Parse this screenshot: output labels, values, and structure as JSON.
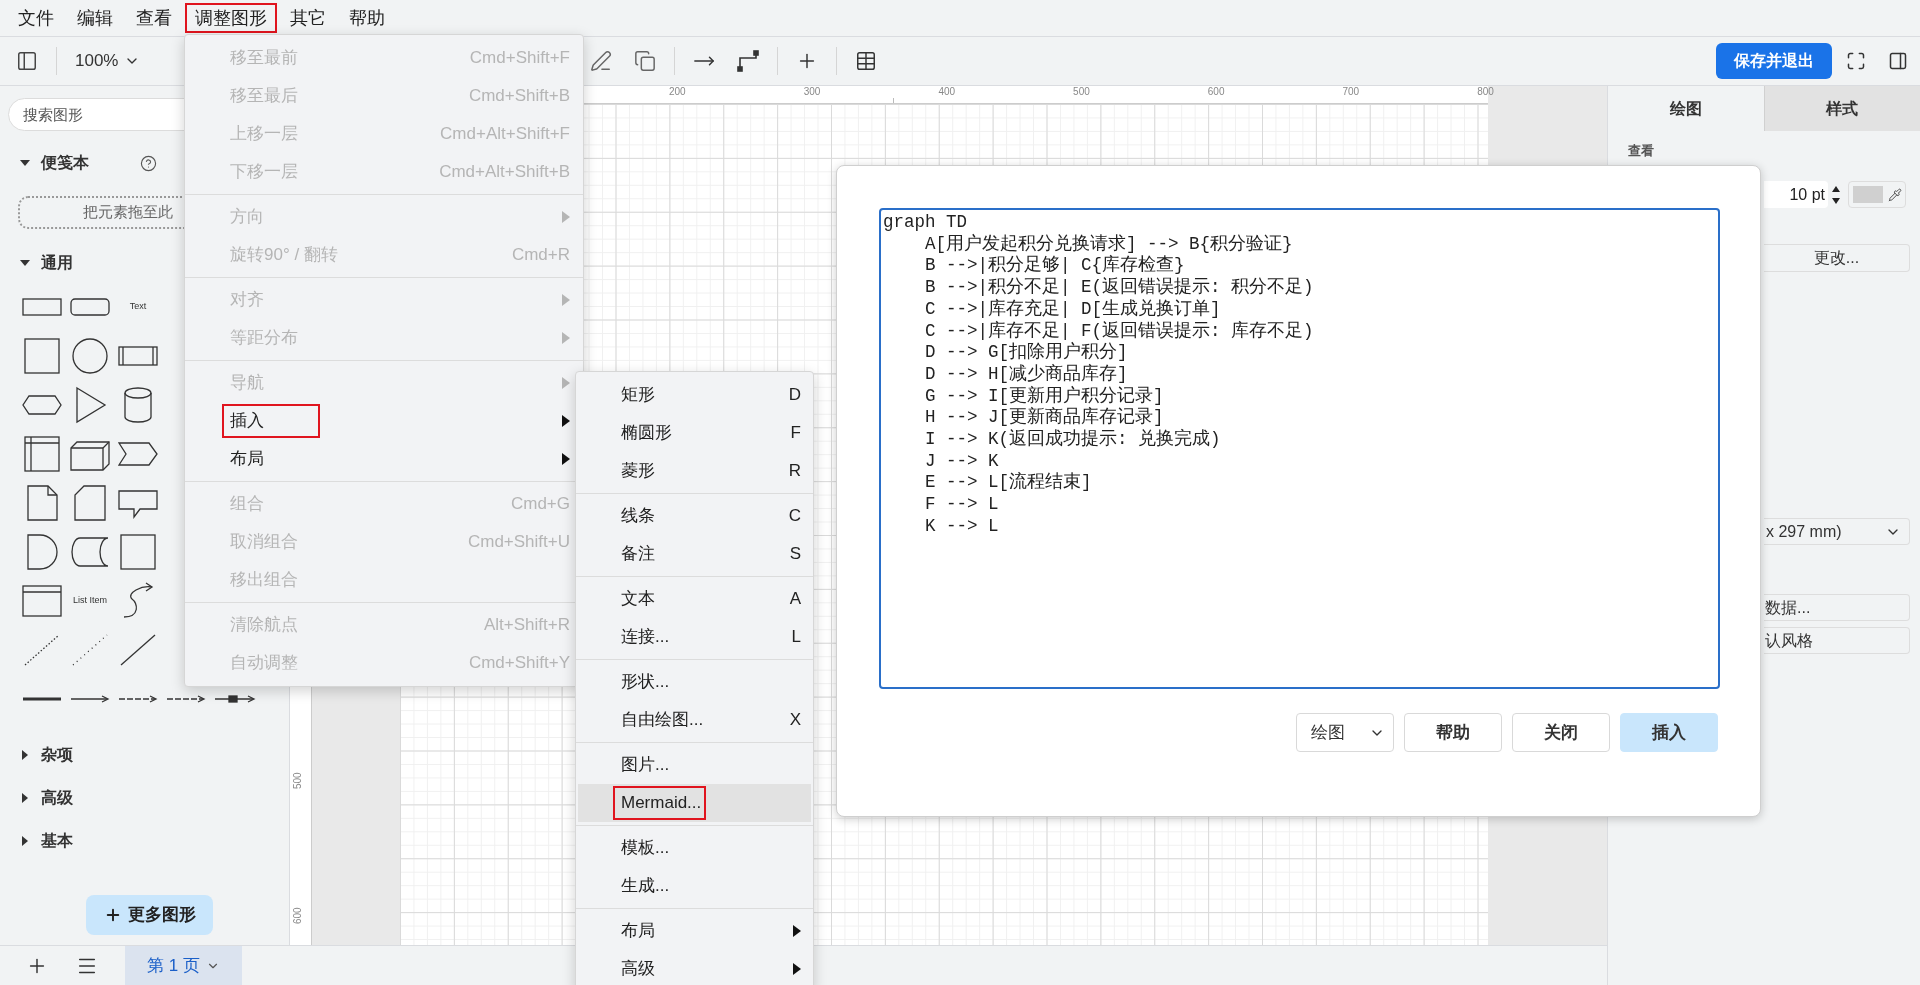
{
  "menubar": [
    {
      "label": "文件",
      "highlighted": false
    },
    {
      "label": "编辑",
      "highlighted": false
    },
    {
      "label": "查看",
      "highlighted": false
    },
    {
      "label": "调整图形",
      "highlighted": true
    },
    {
      "label": "其它",
      "highlighted": false
    },
    {
      "label": "帮助",
      "highlighted": false
    }
  ],
  "toolbar": {
    "zoom": "100%",
    "save_button": "保存并退出"
  },
  "sidebar": {
    "search": {
      "placeholder": "搜索图形"
    },
    "sections": [
      {
        "title": "便笺本",
        "expanded": true,
        "kind": "scratchpad",
        "drop_hint": "把元素拖至此"
      },
      {
        "title": "通用",
        "expanded": true,
        "kind": "shapes",
        "shapes": [
          [
            {
              "kind": "rect"
            },
            {
              "kind": "rounded"
            },
            {
              "kind": "text",
              "label": "Text"
            }
          ],
          [
            {
              "kind": "square"
            },
            {
              "kind": "circle"
            },
            {
              "kind": "process"
            }
          ],
          [
            {
              "kind": "hexagon"
            },
            {
              "kind": "triangle"
            },
            {
              "kind": "cylinder"
            }
          ],
          [
            {
              "kind": "internal-storage"
            },
            {
              "kind": "cube"
            },
            {
              "kind": "step"
            }
          ],
          [
            {
              "kind": "note"
            },
            {
              "kind": "card"
            },
            {
              "kind": "callout"
            }
          ],
          [
            {
              "kind": "delay"
            },
            {
              "kind": "stored-data"
            },
            {
              "kind": "square"
            }
          ],
          [
            {
              "kind": "list"
            },
            {
              "kind": "text",
              "label": "List Item"
            },
            {
              "kind": "curve"
            }
          ],
          [
            {
              "kind": "dotted-line"
            },
            {
              "kind": "dotted-fine"
            },
            {
              "kind": "line"
            }
          ],
          [
            {
              "kind": "thick"
            },
            {
              "kind": "arrow"
            },
            {
              "kind": "arrow-dashed"
            },
            {
              "kind": "arrow-dashed"
            },
            {
              "kind": "arrow-box"
            }
          ]
        ]
      },
      {
        "title": "杂项",
        "expanded": false,
        "kind": "collapsed"
      },
      {
        "title": "高级",
        "expanded": false,
        "kind": "collapsed"
      },
      {
        "title": "基本",
        "expanded": false,
        "kind": "collapsed"
      }
    ],
    "more_shapes": "更多图形"
  },
  "ruler": {
    "x_labels": [
      "200",
      "300",
      "400",
      "500",
      "600",
      "700",
      "800"
    ],
    "y_labels": [
      "500",
      "600"
    ]
  },
  "format_panel": {
    "tabs": [
      {
        "label": "绘图",
        "selected": true
      },
      {
        "label": "样式",
        "selected": false
      }
    ],
    "heading": "查看",
    "grid_size": "10 pt",
    "change_button": "更改...",
    "paper_size": "x 297 mm)",
    "data_button": "数据...",
    "style_button": "认风格"
  },
  "pages": [
    {
      "label": "第 1 页",
      "selected": true
    }
  ],
  "arrange_menu": {
    "groups": [
      [
        {
          "label": "移至最前",
          "shortcut": "Cmd+Shift+F",
          "submenu": false,
          "disabled": true,
          "highlighted": false
        },
        {
          "label": "移至最后",
          "shortcut": "Cmd+Shift+B",
          "submenu": false,
          "disabled": true,
          "highlighted": false
        },
        {
          "label": "上移一层",
          "shortcut": "Cmd+Alt+Shift+F",
          "submenu": false,
          "disabled": true,
          "highlighted": false
        },
        {
          "label": "下移一层",
          "shortcut": "Cmd+Alt+Shift+B",
          "submenu": false,
          "disabled": true,
          "highlighted": false
        }
      ],
      [
        {
          "label": "方向",
          "submenu": true,
          "disabled": true,
          "highlighted": false
        },
        {
          "label": "旋转90° / 翻转",
          "shortcut": "Cmd+R",
          "submenu": false,
          "disabled": true,
          "highlighted": false
        }
      ],
      [
        {
          "label": "对齐",
          "submenu": true,
          "disabled": true,
          "highlighted": false
        },
        {
          "label": "等距分布",
          "submenu": true,
          "disabled": true,
          "highlighted": false
        }
      ],
      [
        {
          "label": "导航",
          "submenu": true,
          "disabled": true,
          "highlighted": false
        },
        {
          "label": "插入",
          "submenu": true,
          "disabled": false,
          "highlighted": true
        },
        {
          "label": "布局",
          "submenu": true,
          "disabled": false,
          "highlighted": false
        }
      ],
      [
        {
          "label": "组合",
          "shortcut": "Cmd+G",
          "submenu": false,
          "disabled": true,
          "highlighted": false
        },
        {
          "label": "取消组合",
          "shortcut": "Cmd+Shift+U",
          "submenu": false,
          "disabled": true,
          "highlighted": false
        },
        {
          "label": "移出组合",
          "submenu": false,
          "disabled": true,
          "highlighted": false
        }
      ],
      [
        {
          "label": "清除航点",
          "shortcut": "Alt+Shift+R",
          "submenu": false,
          "disabled": true,
          "highlighted": false
        },
        {
          "label": "自动调整",
          "shortcut": "Cmd+Shift+Y",
          "submenu": false,
          "disabled": true,
          "highlighted": false
        }
      ]
    ]
  },
  "insert_submenu": {
    "groups": [
      [
        {
          "label": "矩形",
          "shortcut": "D",
          "submenu": false,
          "highlighted": false,
          "hovered": false
        },
        {
          "label": "椭圆形",
          "shortcut": "F",
          "submenu": false,
          "highlighted": false,
          "hovered": false
        },
        {
          "label": "菱形",
          "shortcut": "R",
          "submenu": false,
          "highlighted": false,
          "hovered": false
        }
      ],
      [
        {
          "label": "线条",
          "shortcut": "C",
          "submenu": false,
          "highlighted": false,
          "hovered": false
        },
        {
          "label": "备注",
          "shortcut": "S",
          "submenu": false,
          "highlighted": false,
          "hovered": false
        }
      ],
      [
        {
          "label": "文本",
          "shortcut": "A",
          "submenu": false,
          "highlighted": false,
          "hovered": false
        },
        {
          "label": "连接...",
          "shortcut": "L",
          "submenu": false,
          "highlighted": false,
          "hovered": false
        }
      ],
      [
        {
          "label": "形状...",
          "submenu": false,
          "highlighted": false,
          "hovered": false
        },
        {
          "label": "自由绘图...",
          "shortcut": "X",
          "submenu": false,
          "highlighted": false,
          "hovered": false
        }
      ],
      [
        {
          "label": "图片...",
          "submenu": false,
          "highlighted": false,
          "hovered": false
        },
        {
          "label": "Mermaid...",
          "submenu": false,
          "highlighted": true,
          "hovered": true
        }
      ],
      [
        {
          "label": "模板...",
          "submenu": false,
          "highlighted": false,
          "hovered": false
        },
        {
          "label": "生成...",
          "submenu": false,
          "highlighted": false,
          "hovered": false
        }
      ],
      [
        {
          "label": "布局",
          "submenu": true,
          "highlighted": false,
          "hovered": false
        },
        {
          "label": "高级",
          "submenu": true,
          "highlighted": false,
          "hovered": false
        }
      ]
    ]
  },
  "mermaid_dialog": {
    "code": "graph TD\n    A[用户发起积分兑换请求] --> B{积分验证}\n    B -->|积分足够| C{库存检查}\n    B -->|积分不足| E(返回错误提示: 积分不足)\n    C -->|库存充足| D[生成兑换订单]\n    C -->|库存不足| F(返回错误提示: 库存不足)\n    D --> G[扣除用户积分]\n    D --> H[减少商品库存]\n    G --> I[更新用户积分记录]\n    H --> J[更新商品库存记录]\n    I --> K(返回成功提示: 兑换完成)\n    J --> K\n    E --> L[流程结束]\n    F --> L\n    K --> L",
    "diagram_type": "绘图",
    "buttons": [
      {
        "label": "帮助",
        "kind": "default"
      },
      {
        "label": "关闭",
        "kind": "default"
      },
      {
        "label": "插入",
        "kind": "primary"
      }
    ]
  }
}
